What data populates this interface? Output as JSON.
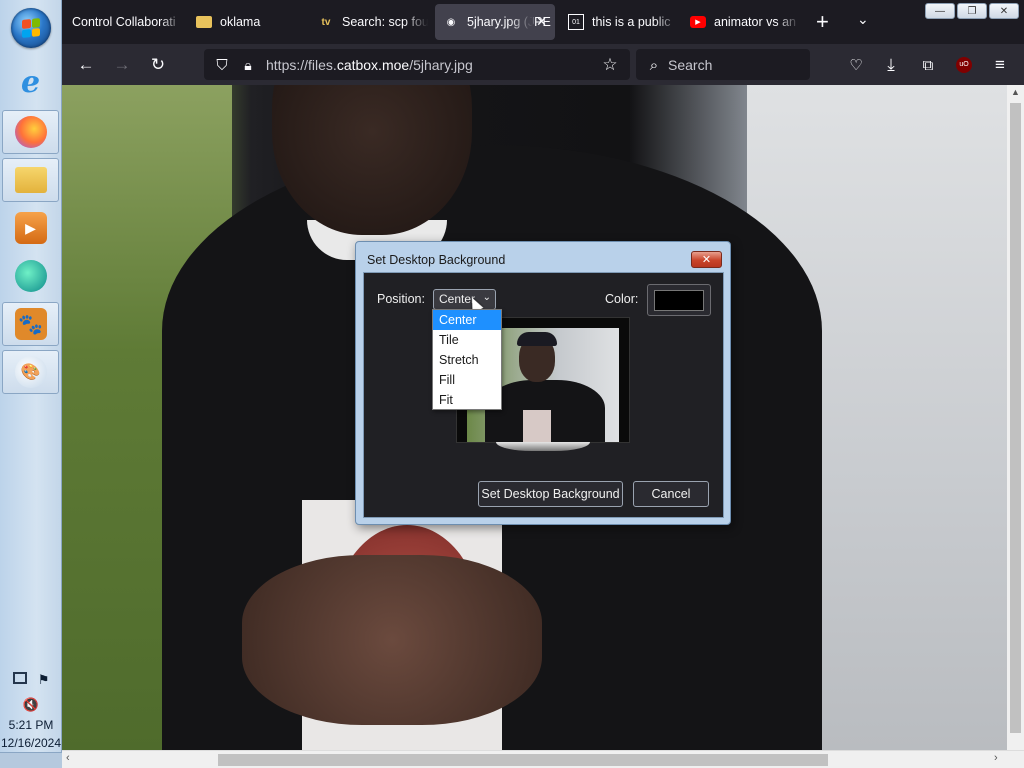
{
  "taskbar": {
    "clock_time": "5:21 PM",
    "clock_date": "12/16/2024",
    "apps": [
      "internet-explorer",
      "firefox",
      "file-explorer",
      "media-player",
      "chat-app",
      "paw-app",
      "paint-app"
    ]
  },
  "tabs": [
    {
      "title": "Control Collaborati",
      "icon": "blank-page-icon"
    },
    {
      "title": "oklama",
      "icon": "folder-icon"
    },
    {
      "title": "Search: scp fou",
      "icon": "tv-icon"
    },
    {
      "title": "5jhary.jpg (JPE",
      "icon": "image-icon",
      "active": true
    },
    {
      "title": "this is a public",
      "icon": "doc-icon"
    },
    {
      "title": "animator vs an",
      "icon": "youtube-icon"
    }
  ],
  "navbar": {
    "url_prefix": "https://files.",
    "url_domain": "catbox.moe",
    "url_path": "/5jhary.jpg",
    "search_placeholder": "Search"
  },
  "dialog": {
    "title": "Set Desktop Background",
    "close_label": "✕",
    "position_label": "Position:",
    "position_value": "Center",
    "color_label": "Color:",
    "color_value": "#000000",
    "set_button": "Set Desktop Background",
    "cancel_button": "Cancel",
    "position_options": [
      "Center",
      "Tile",
      "Stretch",
      "Fill",
      "Fit"
    ],
    "selected_option": "Center"
  },
  "colors": {
    "browser_dark": "#1c1b22",
    "toolbar": "#2b2a33",
    "dropdown_highlight": "#1e90ff",
    "dialog_frame": "#b9d1ea"
  }
}
